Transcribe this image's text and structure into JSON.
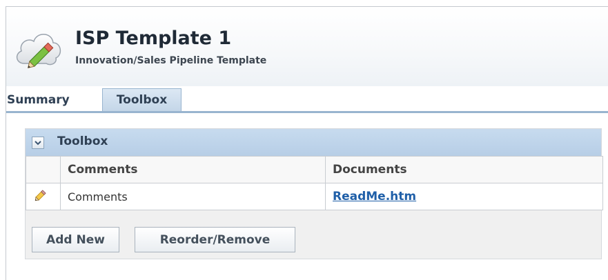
{
  "header": {
    "title": "ISP Template 1",
    "subtitle": "Innovation/Sales Pipeline Template",
    "logo_icon": "cloud-pencil-icon"
  },
  "tabs": [
    {
      "label": "Summary",
      "active": false
    },
    {
      "label": "Toolbox",
      "active": true
    }
  ],
  "webpart": {
    "title": "Toolbox",
    "collapse_icon": "chevron-down-icon",
    "columns": [
      "",
      "Comments",
      "Documents"
    ],
    "rows": [
      {
        "icon": "pencil-icon",
        "comments": "Comments",
        "documents": "ReadMe.htm"
      }
    ],
    "buttons": {
      "add_new": "Add New",
      "reorder_remove": "Reorder/Remove"
    }
  },
  "colors": {
    "tab_active": "#c4d6e8",
    "panel_header": "#c7dbef",
    "link": "#1f5fa8"
  }
}
